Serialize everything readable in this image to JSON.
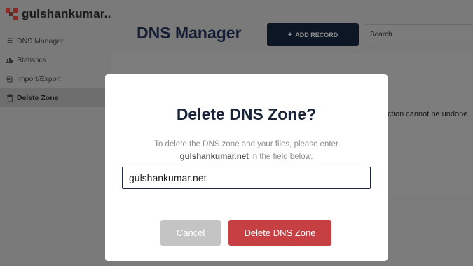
{
  "app": {
    "brand_name": "gulshankumar...."
  },
  "sidebar": {
    "items": [
      {
        "label": "DNS Manager",
        "icon": "list-icon"
      },
      {
        "label": "Statistics",
        "icon": "chart-icon"
      },
      {
        "label": "Import/Export",
        "icon": "import-export-icon"
      },
      {
        "label": "Delete Zone",
        "icon": "trash-icon",
        "active": true
      }
    ]
  },
  "header": {
    "title": "DNS Manager",
    "add_record_label": "ADD RECORD",
    "search_placeholder": "Search ..."
  },
  "background": {
    "warning_text": "ction cannot be undone."
  },
  "modal": {
    "title": "Delete DNS Zone?",
    "desc_line1": "To delete the DNS zone and your files, please enter",
    "zone_name": "gulshankumar.net",
    "desc_line2_suffix": " in the field below.",
    "input_value": "gulshankumar.net",
    "cancel_label": "Cancel",
    "delete_label": "Delete DNS Zone"
  },
  "colors": {
    "overlay": "#7b7b7b",
    "primary_dark": "#0d1624",
    "danger": "#c63f43",
    "cancel_gray": "#c4c4c4",
    "brand_mark": "#8a2a22"
  }
}
